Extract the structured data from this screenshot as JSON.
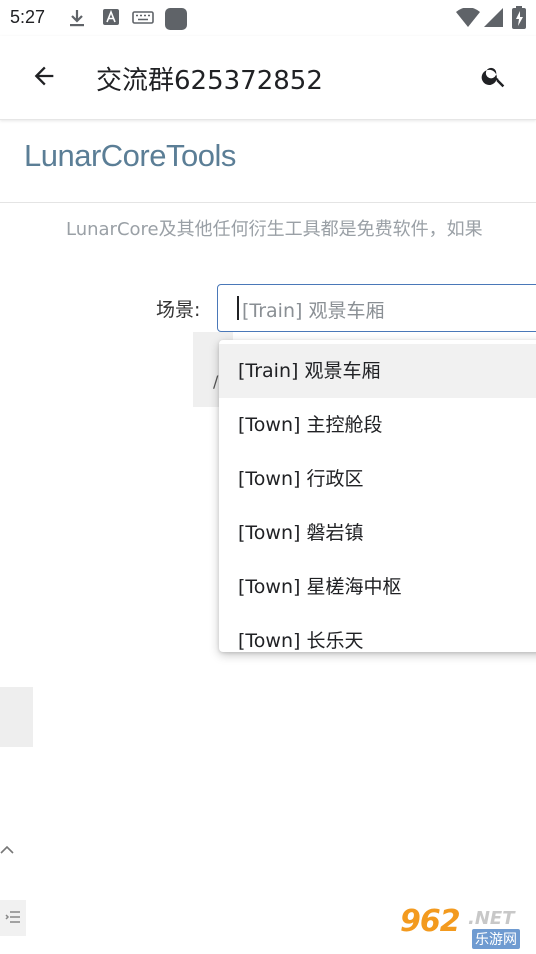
{
  "status_bar": {
    "time": "5:27",
    "icons": [
      "download-icon",
      "a-box-icon",
      "keyboard-icon",
      "app-square-icon",
      "wifi-icon",
      "signal-icon",
      "battery-charging-icon"
    ]
  },
  "app_bar": {
    "title": "交流群625372852",
    "back_icon": "arrow-left-icon",
    "search_icon": "search-icon"
  },
  "page": {
    "heading": "LunarCoreTools",
    "notice": "LunarCore及其他任何衍生工具都是免费软件，如果"
  },
  "scene_field": {
    "label": "场景:",
    "placeholder": "[Train] 观景车厢"
  },
  "hidden_button": {
    "visible_fragment": "/"
  },
  "dropdown": {
    "items": [
      "[Train] 观景车厢",
      "[Town] 主控舱段",
      "[Town] 行政区",
      "[Town] 磐岩镇",
      "[Town] 星槎海中枢",
      "[Town] 长乐天"
    ],
    "selected_index": 0
  },
  "watermark": {
    "number": "962",
    "suffix": ".NET",
    "caption": "乐游网"
  },
  "colors": {
    "heading": "#5b7e96",
    "input_border": "#4a78b8",
    "watermark_orange": "#f39a1e",
    "watermark_blue": "#6f9bd1"
  }
}
